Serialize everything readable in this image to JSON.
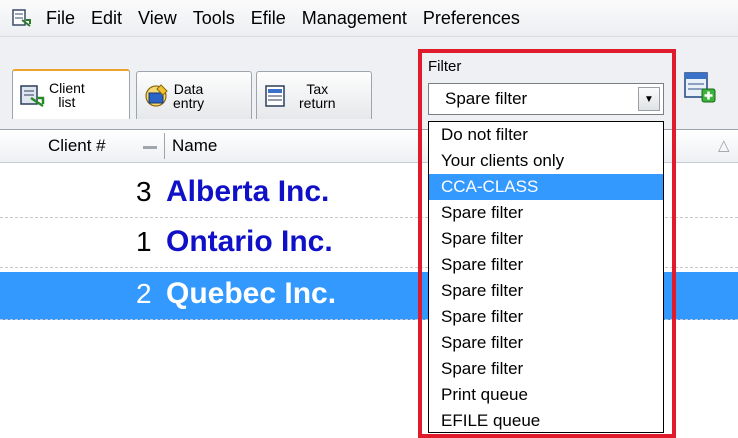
{
  "menubar": {
    "items": [
      "File",
      "Edit",
      "View",
      "Tools",
      "Efile",
      "Management",
      "Preferences"
    ]
  },
  "tabs": [
    {
      "line1": "Client",
      "line2": "list",
      "icon": "client-list-icon",
      "active": true
    },
    {
      "line1": "Data",
      "line2": "entry",
      "icon": "data-entry-icon",
      "active": false
    },
    {
      "line1": "Tax",
      "line2": "return",
      "icon": "tax-return-icon",
      "active": false
    }
  ],
  "filter": {
    "label": "Filter",
    "selected": "Spare filter",
    "options": [
      "Do not filter",
      "Your clients only",
      "CCA-CLASS",
      "Spare filter",
      "Spare filter",
      "Spare filter",
      "Spare filter",
      "Spare filter",
      "Spare filter",
      "Spare filter",
      "Print queue",
      "EFILE queue"
    ],
    "highlighted_index": 2
  },
  "grid": {
    "columns": {
      "client": "Client #",
      "name": "Name"
    },
    "rows": [
      {
        "num": "3",
        "name": "Alberta Inc.",
        "selected": false
      },
      {
        "num": "1",
        "name": "Ontario Inc.",
        "selected": false
      },
      {
        "num": "2",
        "name": "Quebec Inc.",
        "selected": true
      }
    ]
  },
  "colors": {
    "selection": "#3399ff",
    "client_name": "#1010c8",
    "annotation_box": "#e01b2c",
    "active_tab_accent": "#f0a02c"
  }
}
